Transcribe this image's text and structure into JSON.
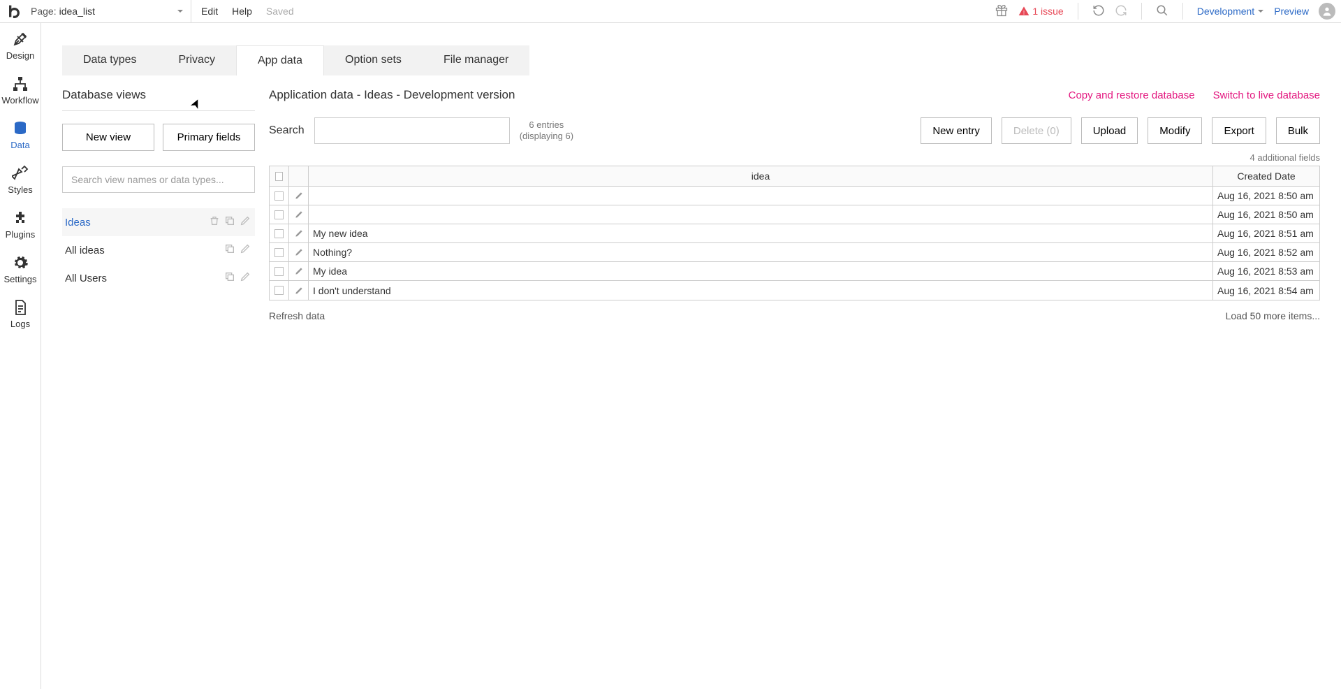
{
  "topbar": {
    "page_prefix": "Page: ",
    "page_name": "idea_list",
    "edit": "Edit",
    "help": "Help",
    "saved": "Saved",
    "issue": "1 issue",
    "env": "Development",
    "preview": "Preview"
  },
  "leftnav": {
    "design": "Design",
    "workflow": "Workflow",
    "data": "Data",
    "styles": "Styles",
    "plugins": "Plugins",
    "settings": "Settings",
    "logs": "Logs"
  },
  "tabs": {
    "data_types": "Data types",
    "privacy": "Privacy",
    "app_data": "App data",
    "option_sets": "Option sets",
    "file_manager": "File manager"
  },
  "views_panel": {
    "heading": "Database views",
    "new_view": "New view",
    "primary_fields": "Primary fields",
    "search_placeholder": "Search view names or data types...",
    "items": [
      {
        "label": "Ideas",
        "active": true,
        "icons": [
          "trash",
          "copy",
          "pencil"
        ]
      },
      {
        "label": "All ideas",
        "active": false,
        "icons": [
          "copy",
          "pencil"
        ]
      },
      {
        "label": "All Users",
        "active": false,
        "icons": [
          "copy",
          "pencil"
        ]
      }
    ]
  },
  "data_panel": {
    "title": "Application data - Ideas - Development version",
    "link_copy": "Copy and restore database",
    "link_switch": "Switch to live database",
    "search_label": "Search",
    "entries_l1": "6 entries",
    "entries_l2": "(displaying 6)",
    "btn_new": "New entry",
    "btn_delete": "Delete (0)",
    "btn_upload": "Upload",
    "btn_modify": "Modify",
    "btn_export": "Export",
    "btn_bulk": "Bulk",
    "additional": "4 additional fields",
    "col_idea": "idea",
    "col_date": "Created Date",
    "rows": [
      {
        "idea": "",
        "date": "Aug 16, 2021 8:50 am"
      },
      {
        "idea": "",
        "date": "Aug 16, 2021 8:50 am"
      },
      {
        "idea": "My new idea",
        "date": "Aug 16, 2021 8:51 am"
      },
      {
        "idea": "Nothing?",
        "date": "Aug 16, 2021 8:52 am"
      },
      {
        "idea": "My idea",
        "date": "Aug 16, 2021 8:53 am"
      },
      {
        "idea": "I don't understand",
        "date": "Aug 16, 2021 8:54 am"
      }
    ],
    "refresh": "Refresh data",
    "loadmore": "Load 50 more items..."
  }
}
